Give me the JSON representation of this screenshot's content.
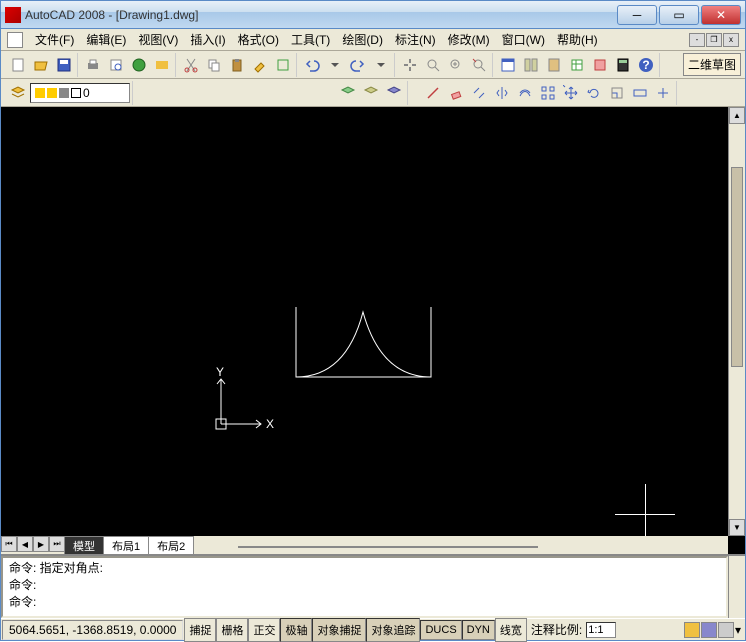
{
  "window": {
    "app_name": "AutoCAD 2008",
    "doc_name": "[Drawing1.dwg]"
  },
  "menu": {
    "items": [
      {
        "label": "文件(F)"
      },
      {
        "label": "编辑(E)"
      },
      {
        "label": "视图(V)"
      },
      {
        "label": "插入(I)"
      },
      {
        "label": "格式(O)"
      },
      {
        "label": "工具(T)"
      },
      {
        "label": "绘图(D)"
      },
      {
        "label": "标注(N)"
      },
      {
        "label": "修改(M)"
      },
      {
        "label": "窗口(W)"
      },
      {
        "label": "帮助(H)"
      }
    ]
  },
  "toolbar_ext_label": "二维草图",
  "layer": {
    "name": "0"
  },
  "tabs": [
    {
      "label": "模型",
      "active": true
    },
    {
      "label": "布局1",
      "active": false
    },
    {
      "label": "布局2",
      "active": false
    }
  ],
  "command": {
    "line1": "命令: 指定对角点:",
    "line2": "命令:",
    "prompt": "命令:"
  },
  "status": {
    "coords": "5064.5651, -1368.8519, 0.0000",
    "toggles": [
      {
        "label": "捕捉",
        "pressed": false
      },
      {
        "label": "栅格",
        "pressed": false
      },
      {
        "label": "正交",
        "pressed": false
      },
      {
        "label": "极轴",
        "pressed": true
      },
      {
        "label": "对象捕捉",
        "pressed": true
      },
      {
        "label": "对象追踪",
        "pressed": true
      },
      {
        "label": "DUCS",
        "pressed": true
      },
      {
        "label": "DYN",
        "pressed": true
      },
      {
        "label": "线宽",
        "pressed": false
      }
    ],
    "anno_label": "注释比例:",
    "anno_scale": "1:1"
  },
  "ucs": {
    "x": "X",
    "y": "Y"
  }
}
